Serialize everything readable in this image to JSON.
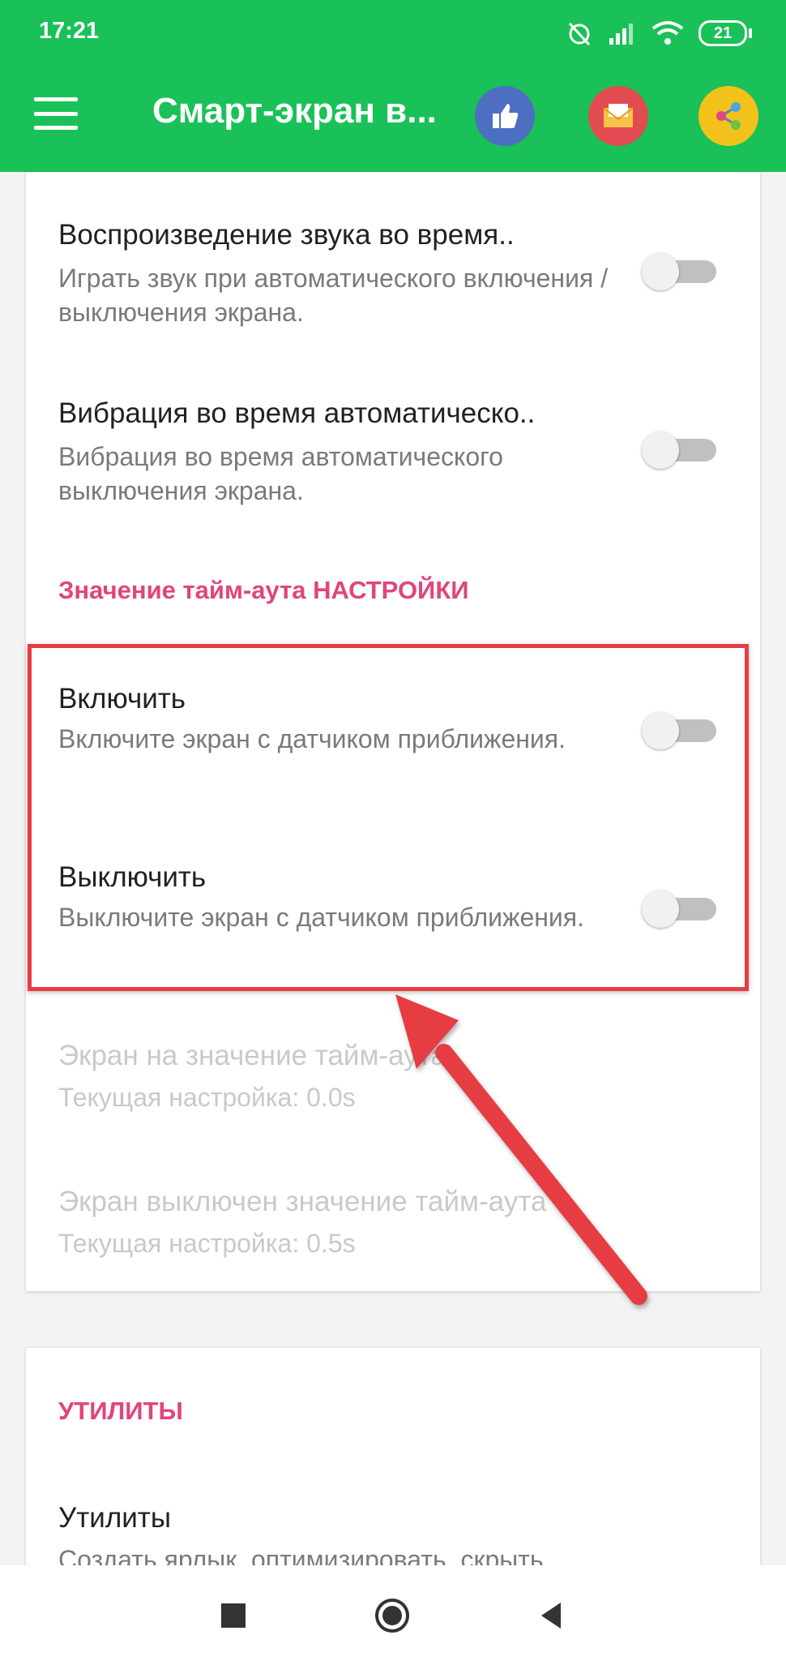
{
  "status_bar": {
    "time": "17:21",
    "battery": "21"
  },
  "app_bar": {
    "title": "Смарт-экран в...",
    "menu_icon": "hamburger-menu-icon",
    "actions": [
      {
        "icon": "thumbs-up-icon",
        "color": "#4c6fc2"
      },
      {
        "icon": "mail-icon",
        "color": "#e24b50"
      },
      {
        "icon": "share-icon",
        "color": "#f3c21a"
      }
    ]
  },
  "settings": {
    "sound": {
      "title": "Воспроизведение звука во время..",
      "summary": "Играть звук при автоматического включения / выключения экрана.",
      "enabled": false
    },
    "vibration": {
      "title": "Вибрация во время автоматическо..",
      "summary": "Вибрация во время автоматического выключения экрана.",
      "enabled": false
    },
    "timeout_section": "Значение тайм-аута НАСТРОЙКИ",
    "turn_on": {
      "title": "Включить",
      "summary": "Включите экран с датчиком приближения.",
      "enabled": false
    },
    "turn_off": {
      "title": "Выключить",
      "summary": "Выключите экран с датчиком приближения.",
      "enabled": false
    },
    "screen_on_timeout": {
      "title": "Экран на значение тайм-аута",
      "summary": "Текущая настройка: 0.0s"
    },
    "screen_off_timeout": {
      "title": "Экран выключен значение тайм-аута",
      "summary": "Текущая настройка: 0.5s"
    }
  },
  "utilities": {
    "section": "УТИЛИТЫ",
    "item": {
      "title": "Утилиты",
      "summary": "Создать ярлык, оптимизировать, скрыть"
    }
  },
  "colors": {
    "accent_green": "#19c158",
    "section_pink": "#e0457b",
    "highlight_red": "#e53d43"
  }
}
